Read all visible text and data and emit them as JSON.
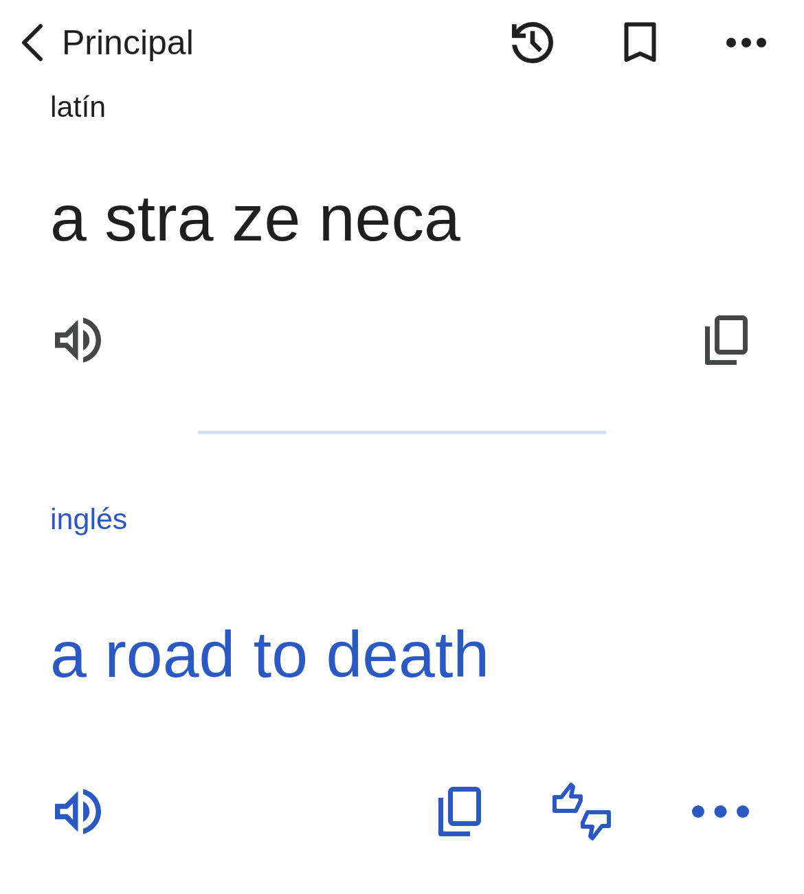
{
  "top_bar": {
    "back_label": "Principal"
  },
  "source": {
    "language": "latín",
    "text": "a stra ze neca"
  },
  "translation": {
    "language": "inglés",
    "text": "a road to death"
  }
}
